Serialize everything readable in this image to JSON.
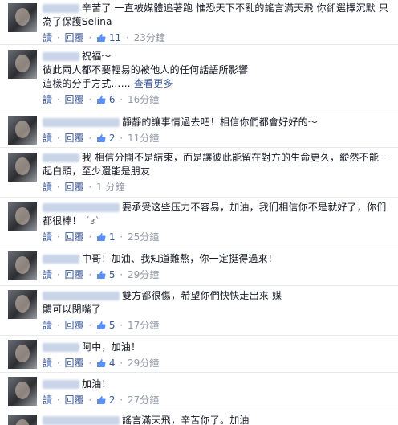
{
  "actions": {
    "reply_label": "讀",
    "reply2_label": "回覆",
    "separator": "·"
  },
  "comments": [
    {
      "text": "辛苦了 一直被媒體追著跑 惟恐天下不亂的謠言滿天飛 你卻選擇沉默 只為了保護Selina",
      "likes": "11",
      "time": "23分鐘"
    },
    {
      "text_line1": "祝福～",
      "text_line2": "彼此兩人都不要輕易的被他人的任何話語所影響",
      "text_line3": "這樣的分手方式……",
      "see_more": "查看更多",
      "likes": "6",
      "time": "16分鐘"
    },
    {
      "text": "靜靜的讓事情過去吧！相信你們都會好好的～",
      "likes": "2",
      "time": "11分鐘"
    },
    {
      "text": "我 相信分開不是結束，而是讓彼此能留在對方的生命更久，縱然不能一起白頭，至少還能是朋友",
      "time": "1 分鐘"
    },
    {
      "text": "要承受这些压力不容易，加油，我们相信你不是就好了，你们都很棒！",
      "emoji": "´ɜ`",
      "likes": "1",
      "time": "25分鐘"
    },
    {
      "text": "中哥！加油、我知道難熬，你一定挺得過來！",
      "likes": "5",
      "time": "29分鐘"
    },
    {
      "text": "雙方都很傷，希望你們快快走出來 媒體可以閉嘴了",
      "likes": "5",
      "time": "17分鐘"
    },
    {
      "text": "阿中，加油！",
      "likes": "4",
      "time": "29分鐘"
    },
    {
      "text": "加油！",
      "likes": "2",
      "time": "27分鐘"
    },
    {
      "text": "謠言滿天飛，辛苦你了。加油"
    }
  ]
}
